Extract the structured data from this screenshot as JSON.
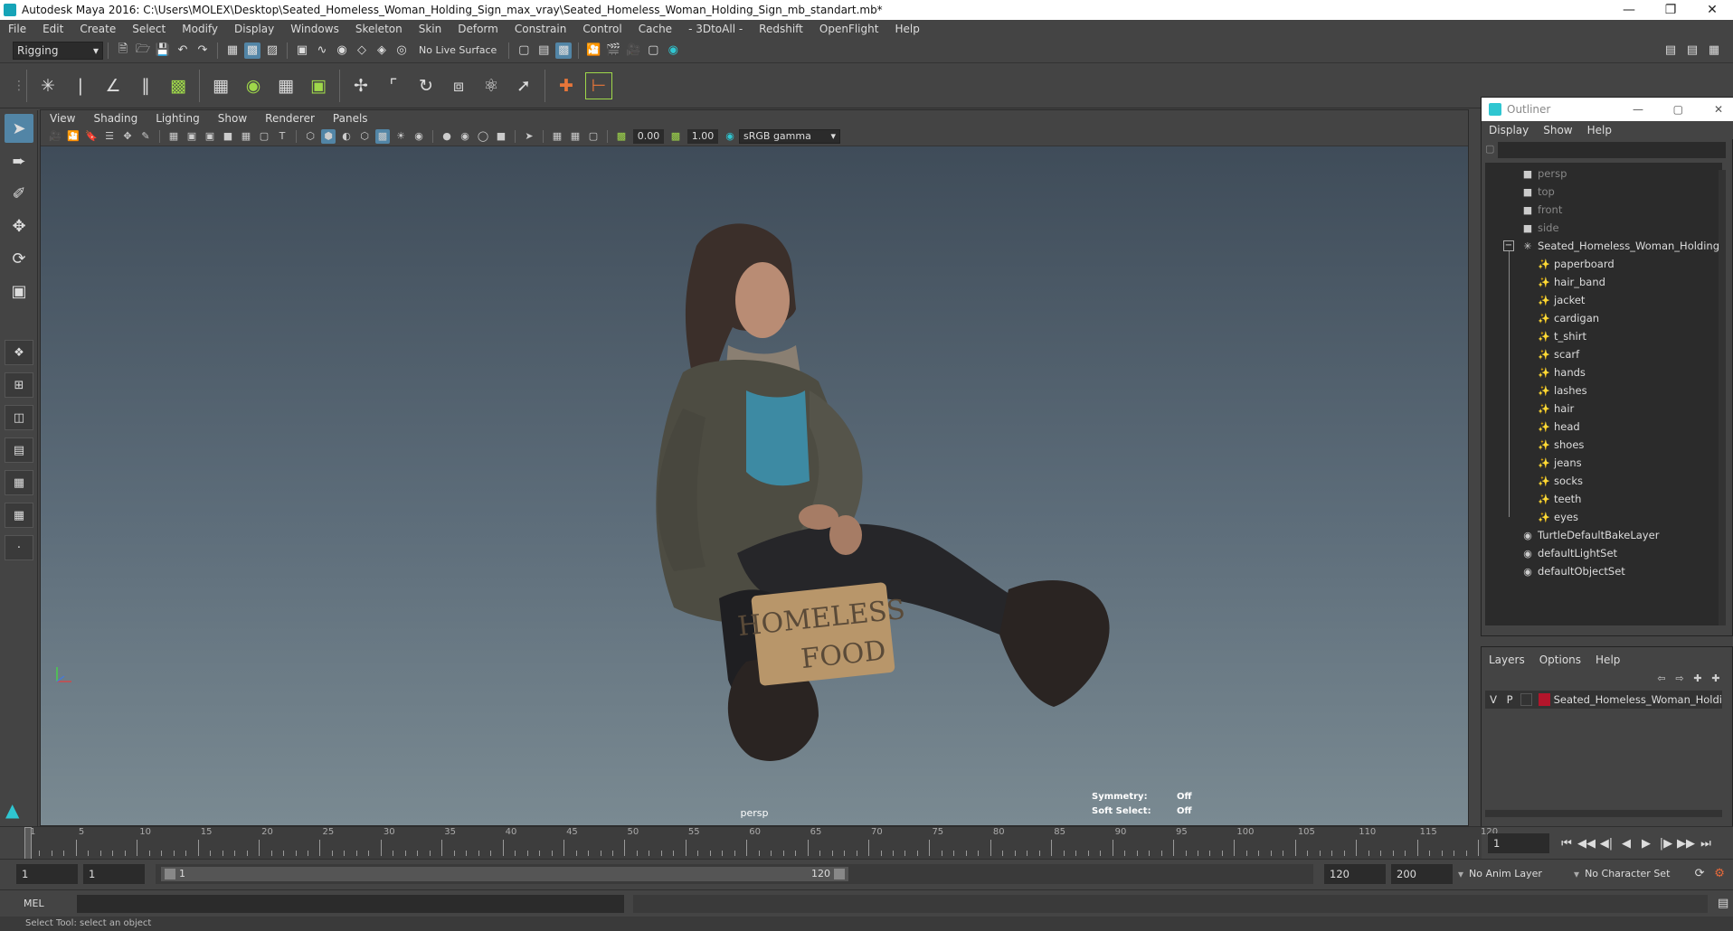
{
  "titlebar": {
    "text": "Autodesk Maya 2016: C:\\Users\\MOLEX\\Desktop\\Seated_Homeless_Woman_Holding_Sign_max_vray\\Seated_Homeless_Woman_Holding_Sign_mb_standart.mb*"
  },
  "menubar": [
    "File",
    "Edit",
    "Create",
    "Select",
    "Modify",
    "Display",
    "Windows",
    "Skeleton",
    "Skin",
    "Deform",
    "Constrain",
    "Control",
    "Cache",
    "- 3DtoAll -",
    "Redshift",
    "OpenFlight",
    "Help"
  ],
  "statusline": {
    "menuset": "Rigging",
    "live_surface": "No Live Surface"
  },
  "viewport": {
    "menu": [
      "View",
      "Shading",
      "Lighting",
      "Show",
      "Renderer",
      "Panels"
    ],
    "exposure": "0.00",
    "gamma": "1.00",
    "colorspace": "sRGB gamma",
    "camera": "persp",
    "symmetry_label": "Symmetry:",
    "symmetry_value": "Off",
    "soft_select_label": "Soft Select:",
    "soft_select_value": "Off",
    "sign_text_1": "HOMELESS",
    "sign_text_2": "FOOD"
  },
  "outliner": {
    "title": "Outliner",
    "menu": [
      "Display",
      "Show",
      "Help"
    ],
    "cameras": [
      "persp",
      "top",
      "front",
      "side"
    ],
    "root": "Seated_Homeless_Woman_Holding_S",
    "children": [
      "paperboard",
      "hair_band",
      "jacket",
      "cardigan",
      "t_shirt",
      "scarf",
      "hands",
      "lashes",
      "hair",
      "head",
      "shoes",
      "jeans",
      "socks",
      "teeth",
      "eyes"
    ],
    "sets": [
      "TurtleDefaultBakeLayer",
      "defaultLightSet",
      "defaultObjectSet"
    ]
  },
  "layers": {
    "menu": [
      "Layers",
      "Options",
      "Help"
    ],
    "row": {
      "v": "V",
      "p": "P",
      "name": "Seated_Homeless_Woman_Holdi",
      "color": "#b3152b"
    }
  },
  "timeslider": {
    "ticks": [
      "1",
      "5",
      "10",
      "15",
      "20",
      "25",
      "30",
      "35",
      "40",
      "45",
      "50",
      "55",
      "60",
      "65",
      "70",
      "75",
      "80",
      "85",
      "90",
      "95",
      "100",
      "105",
      "110",
      "115",
      "120"
    ],
    "current_frame": "1"
  },
  "rangeslider": {
    "start": "1",
    "playback_start": "1",
    "range_start_label": "1",
    "range_end_label": "120",
    "playback_end": "120",
    "end": "200",
    "anim_layer": "No Anim Layer",
    "character_set": "No Character Set"
  },
  "cmdline": {
    "label": "MEL"
  },
  "helpline": {
    "text": "Select Tool: select an object"
  }
}
